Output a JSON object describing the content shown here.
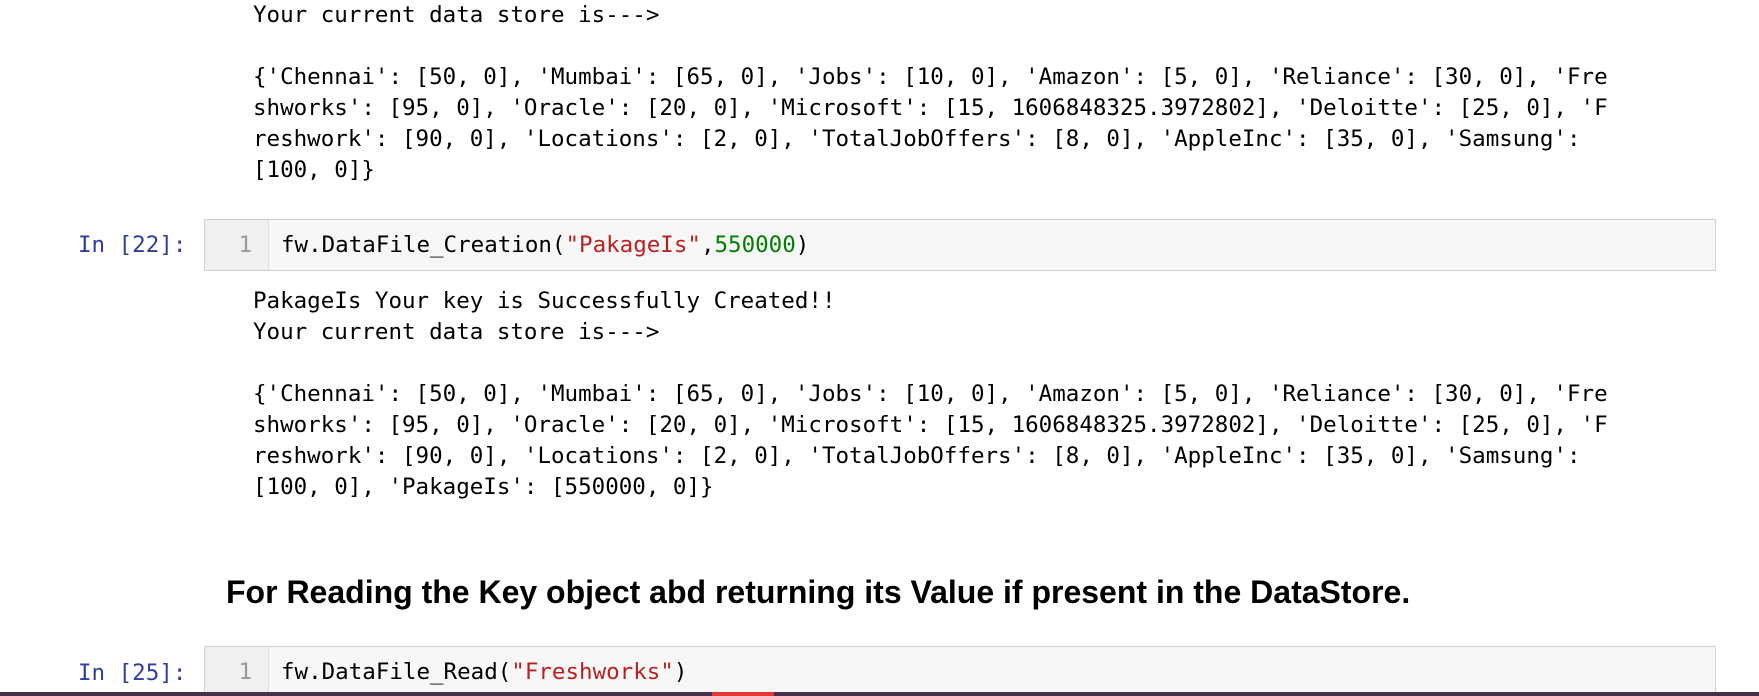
{
  "output_top": {
    "line1": "Your current data store is--->",
    "line2": "",
    "line3": "{'Chennai': [50, 0], 'Mumbai': [65, 0], 'Jobs': [10, 0], 'Amazon': [5, 0], 'Reliance': [30, 0], 'Fre",
    "line4": "shworks': [95, 0], 'Oracle': [20, 0], 'Microsoft': [15, 1606848325.3972802], 'Deloitte': [25, 0], 'F",
    "line5": "reshwork': [90, 0], 'Locations': [2, 0], 'TotalJobOffers': [8, 0], 'AppleInc': [35, 0], 'Samsung':",
    "line6": "[100, 0]}"
  },
  "cell22": {
    "prompt": "In [22]:",
    "line_number": "1",
    "code_call": "fw.DataFile_Creation(",
    "code_arg1": "\"PakageIs\"",
    "code_comma": ",",
    "code_arg2": "550000",
    "code_close": ")"
  },
  "output22": {
    "line1": "PakageIs Your key is Successfully Created!!",
    "line2": "Your current data store is--->",
    "line3": "",
    "line4": "{'Chennai': [50, 0], 'Mumbai': [65, 0], 'Jobs': [10, 0], 'Amazon': [5, 0], 'Reliance': [30, 0], 'Fre",
    "line5": "shworks': [95, 0], 'Oracle': [20, 0], 'Microsoft': [15, 1606848325.3972802], 'Deloitte': [25, 0], 'F",
    "line6": "reshwork': [90, 0], 'Locations': [2, 0], 'TotalJobOffers': [8, 0], 'AppleInc': [35, 0], 'Samsung':",
    "line7": "[100, 0], 'PakageIs': [550000, 0]}"
  },
  "markdown": {
    "heading": "For Reading the Key object abd returning its Value if present in the DataStore."
  },
  "cell25": {
    "prompt": "In [25]:",
    "line_number": "1",
    "code_call": "fw.DataFile_Read(",
    "code_arg1": "\"Freshworks\"",
    "code_close": ")"
  },
  "colors": {
    "prompt": "#303f9f",
    "string": "#ba2121",
    "number": "#008000",
    "input_background": "#f7f7f7"
  }
}
